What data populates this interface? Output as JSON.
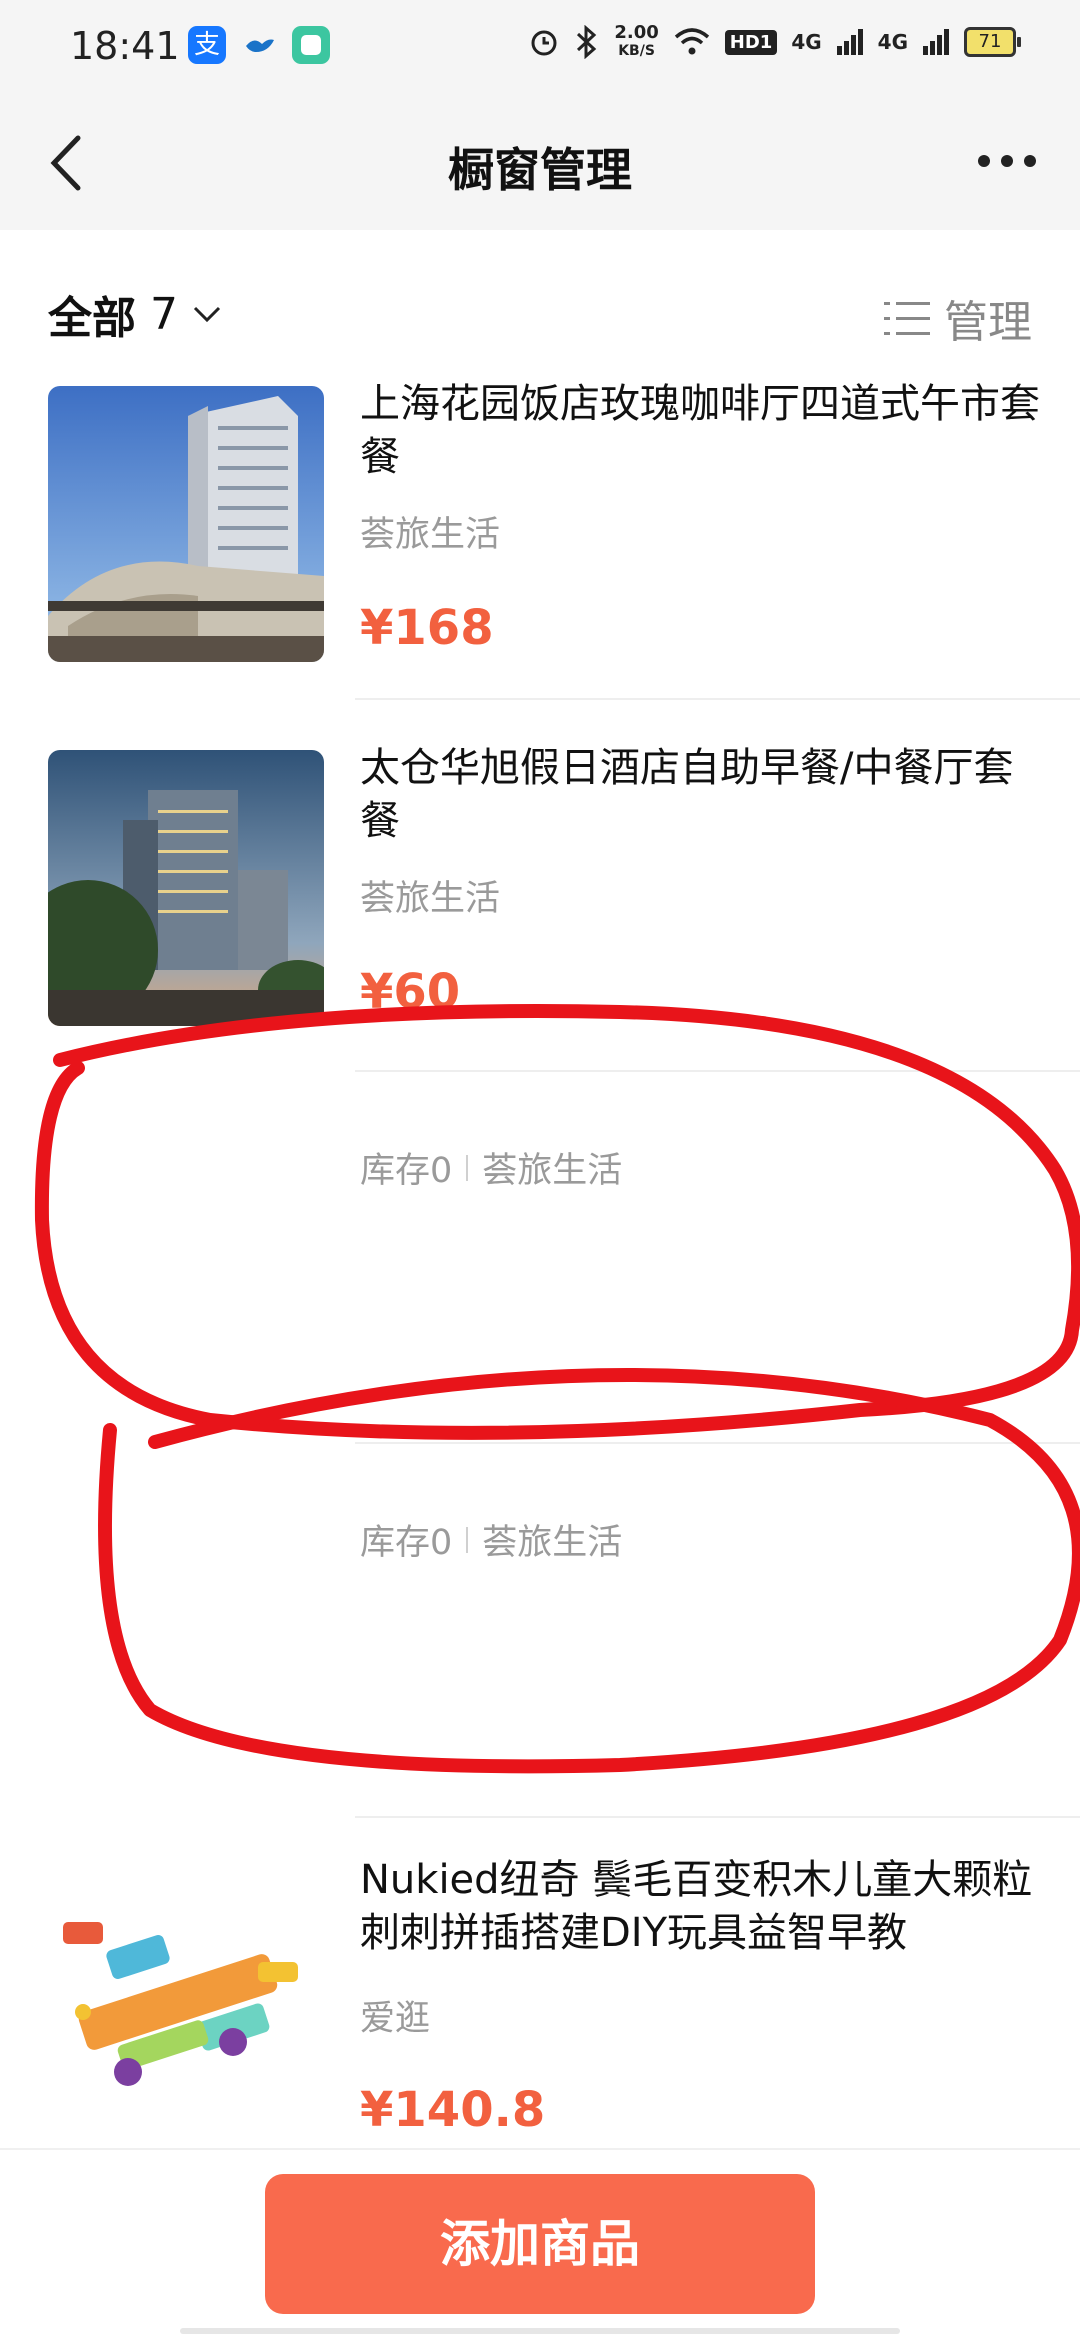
{
  "status_bar": {
    "time": "18:41",
    "network_speed_value": "2.00",
    "network_speed_unit": "KB/S",
    "hd_label": "HD1",
    "signal_1": "4G",
    "signal_2": "4G",
    "battery": "71",
    "app_icon_alipay": "支"
  },
  "header": {
    "title": "橱窗管理"
  },
  "filter": {
    "all_label": "全部",
    "count": "7",
    "manage_label": "管理"
  },
  "items": [
    {
      "title": "上海花园饭店玫瑰咖啡厅四道式午市套餐",
      "shop": "荟旅生活",
      "price": "¥168"
    },
    {
      "title": "太仓华旭假日酒店自助早餐/中餐厅套餐",
      "shop": "荟旅生活",
      "price": "¥60"
    },
    {
      "stock": "库存0",
      "shop": "荟旅生活"
    },
    {
      "stock": "库存0",
      "shop": "荟旅生活"
    },
    {
      "title": "Nukied纽奇 鬓毛百变积木儿童大颗粒刺刺拼插搭建DIY玩具益智早教",
      "shop": "爱逛",
      "price": "¥140.8"
    }
  ],
  "bottom": {
    "add_button": "添加商品"
  },
  "colors": {
    "accent": "#f96a4d",
    "price": "#f2603f",
    "annotation": "#e8141a"
  }
}
